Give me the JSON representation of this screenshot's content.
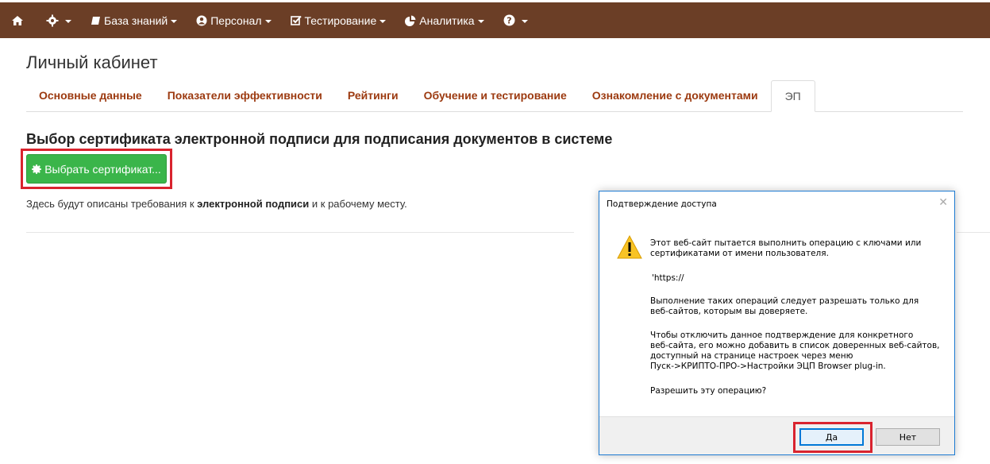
{
  "nav": {
    "knowledge": "База знаний",
    "personnel": "Персонал",
    "testing": "Тестирование",
    "analytics": "Аналитика"
  },
  "page": {
    "title": "Личный кабинет",
    "tabs": [
      {
        "label": "Основные данные"
      },
      {
        "label": "Показатели эффективности"
      },
      {
        "label": "Рейтинги"
      },
      {
        "label": "Обучение и тестирование"
      },
      {
        "label": "Ознакомление с документами"
      },
      {
        "label": "ЭП"
      }
    ],
    "section_title": "Выбор сертификата электронной подписи для подписания документов в системе",
    "select_cert_button": "Выбрать сертификат...",
    "desc_before": "Здесь будут описаны требования к ",
    "desc_bold": "электронной подписи",
    "desc_after": " и к рабочему месту."
  },
  "dialog": {
    "title": "Подтверждение доступа",
    "line1": "Этот веб-сайт пытается выполнить операцию с ключами или",
    "line2": "сертификатами от имени пользователя.",
    "url": "'https://",
    "para2_line1": "Выполнение таких операций следует разрешать только для",
    "para2_line2": "веб-сайтов, которым вы доверяете.",
    "para3_line1": "Чтобы отключить данное подтверждение для конкретного",
    "para3_line2": "веб-сайта, его можно добавить в список доверенных веб-сайтов,",
    "para3_line3": "доступный на странице настроек через меню",
    "para3_line4": "Пуск->КРИПТО-ПРО->Настройки ЭЦП Browser plug-in.",
    "question": "Разрешить эту операцию?",
    "yes_label": "Да",
    "no_label": "Нет"
  },
  "colors": {
    "navbar": "#6b3e26",
    "tab_link": "#9c3a10",
    "button_green": "#3ab54a",
    "highlight": "#d9232e"
  }
}
